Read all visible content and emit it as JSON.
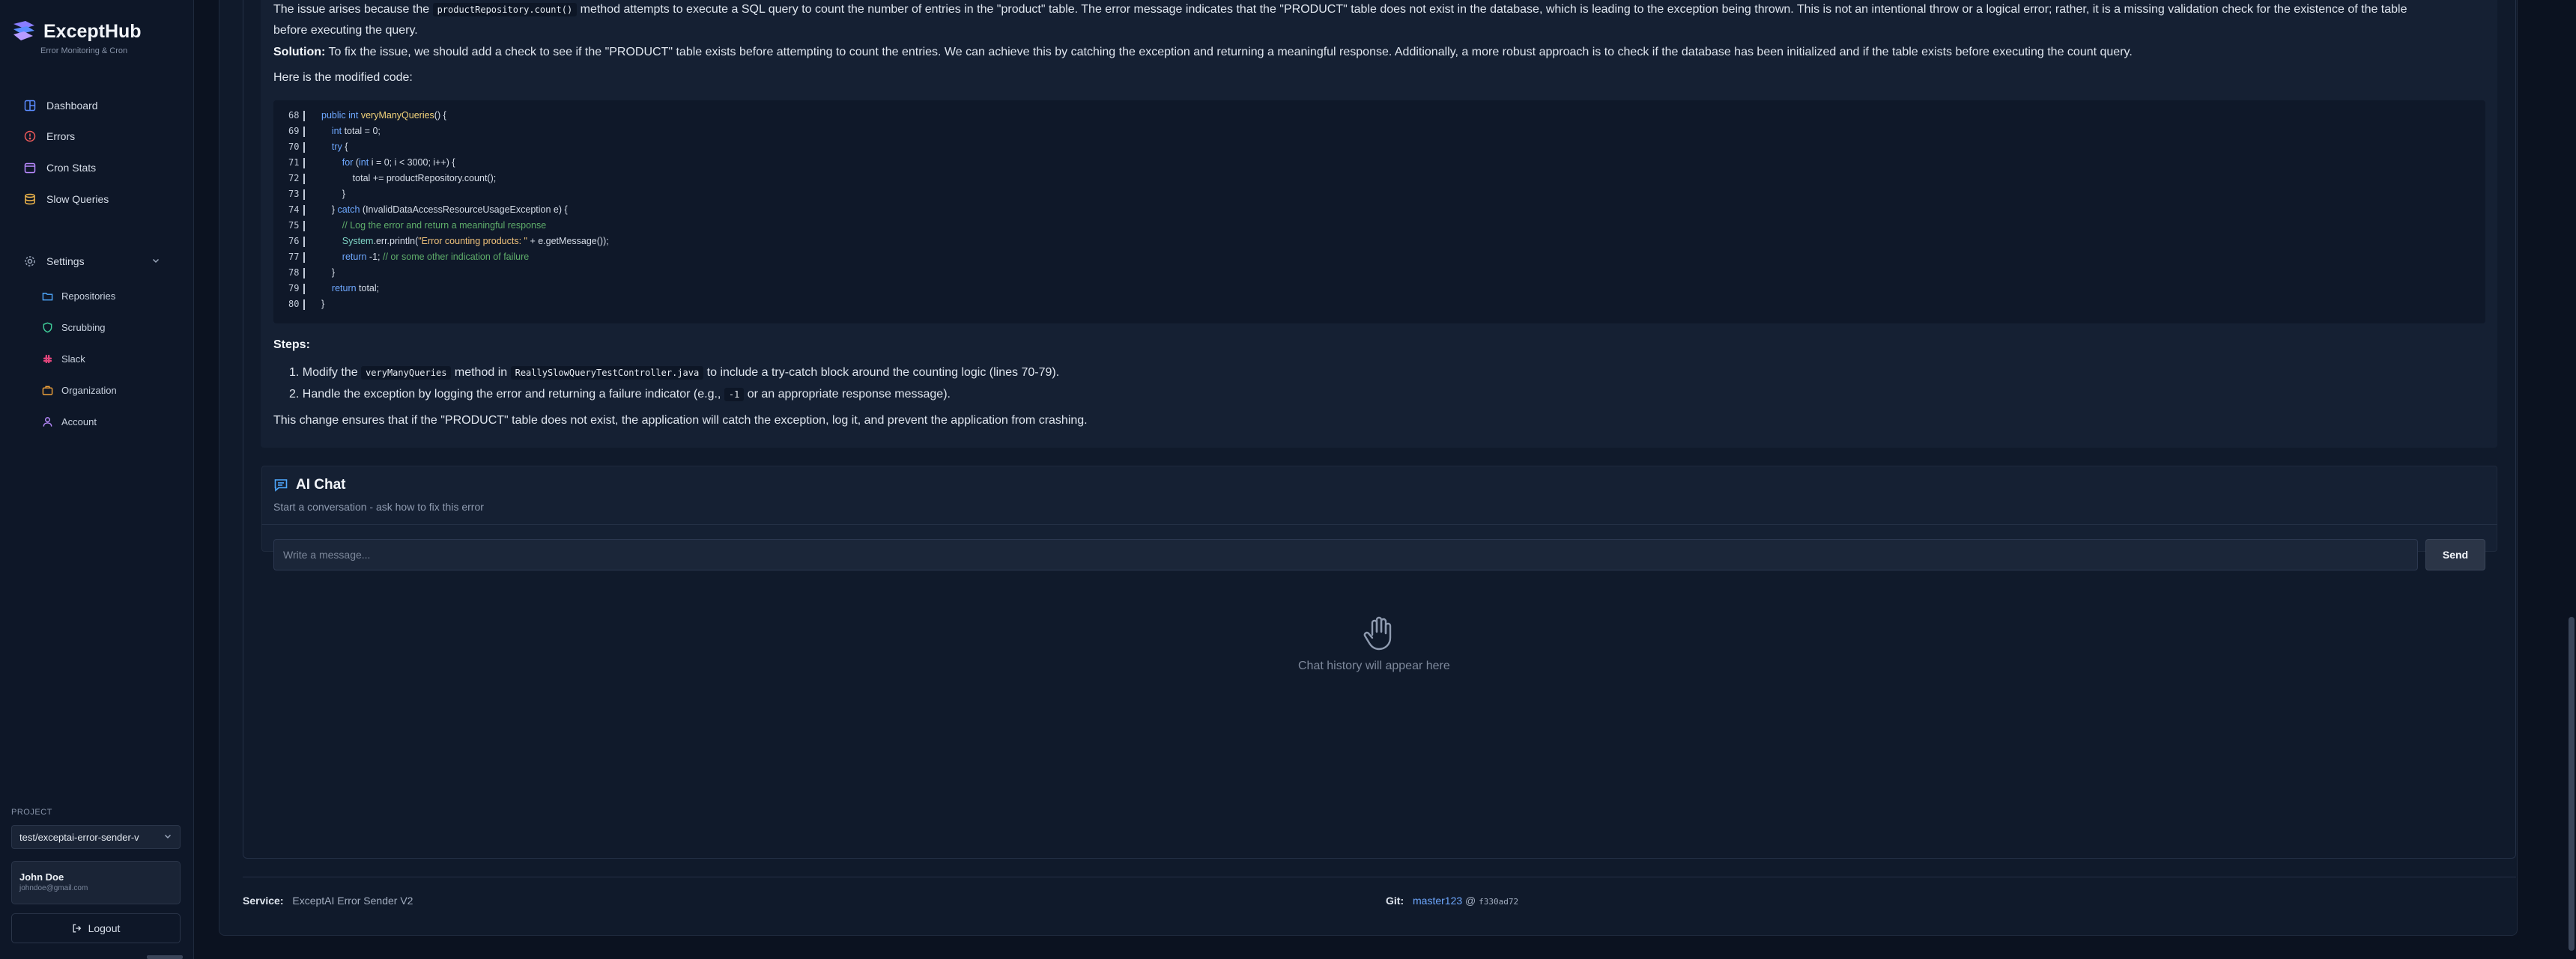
{
  "app": {
    "name": "ExceptHub",
    "subtitle": "Error Monitoring & Cron"
  },
  "sidebar": {
    "items": [
      {
        "label": "Dashboard",
        "icon": "dashboard-icon"
      },
      {
        "label": "Errors",
        "icon": "alert-circle-icon"
      },
      {
        "label": "Cron Stats",
        "icon": "calendar-icon"
      },
      {
        "label": "Slow Queries",
        "icon": "database-icon"
      }
    ],
    "settings": {
      "label": "Settings",
      "icon": "gear-icon",
      "expanded": true,
      "children": [
        {
          "label": "Repositories",
          "icon": "folder-icon"
        },
        {
          "label": "Scrubbing",
          "icon": "shield-icon"
        },
        {
          "label": "Slack",
          "icon": "slack-icon"
        },
        {
          "label": "Organization",
          "icon": "briefcase-icon"
        },
        {
          "label": "Account",
          "icon": "user-icon"
        }
      ]
    },
    "project_label": "PROJECT",
    "project_value": "test/exceptai-error-sender-v",
    "user": {
      "name": "John Doe",
      "email": "johndoe@gmail.com"
    },
    "logout_label": "Logout"
  },
  "analysis": {
    "para1_before": "The issue arises because the ",
    "para1_code": "productRepository.count()",
    "para1_after": " method attempts to execute a SQL query to count the number of entries in the \"product\" table. The error message indicates that the \"PRODUCT\" table does not exist in the database, which is leading to the exception being thrown. This is not an intentional throw or a logical error; rather, it is a missing validation check for the existence of the table before executing the query.",
    "solution_label": "Solution:",
    "solution_text": " To fix the issue, we should add a check to see if the \"PRODUCT\" table exists before attempting to count the entries. We can achieve this by catching the exception and returning a meaningful response. Additionally, a more robust approach is to check if the database has been initialized and if the table exists before executing the count query.",
    "modified_code_label": "Here is the modified code:",
    "code_lines": [
      {
        "n": "68",
        "text": "public int veryManyQueries() {"
      },
      {
        "n": "69",
        "text": "    int total = 0;"
      },
      {
        "n": "70",
        "text": "    try {"
      },
      {
        "n": "71",
        "text": "        for (int i = 0; i < 3000; i++) {"
      },
      {
        "n": "72",
        "text": "            total += productRepository.count();"
      },
      {
        "n": "73",
        "text": "        }"
      },
      {
        "n": "74",
        "text": "    } catch (InvalidDataAccessResourceUsageException e) {"
      },
      {
        "n": "75",
        "text": "        // Log the error and return a meaningful response"
      },
      {
        "n": "76",
        "text": "        System.err.println(\"Error counting products: \" + e.getMessage());"
      },
      {
        "n": "77",
        "text": "        return -1; // or some other indication of failure"
      },
      {
        "n": "78",
        "text": "    }"
      },
      {
        "n": "79",
        "text": "    return total;"
      },
      {
        "n": "80",
        "text": "}"
      }
    ],
    "steps_title": "Steps:",
    "step1_num": "1.",
    "step1_before": "Modify the ",
    "step1_code1": "veryManyQueries",
    "step1_mid": " method in ",
    "step1_code2": "ReallySlowQueryTestController.java",
    "step1_after": " to include a try-catch block around the counting logic (lines 70-79).",
    "step2_num": "2.",
    "step2_before": "Handle the exception by logging the error and returning a failure indicator (e.g., ",
    "step2_code": "-1",
    "step2_after": " or an appropriate response message).",
    "conclusion": "This change ensures that if the \"PRODUCT\" table does not exist, the application will catch the exception, log it, and prevent the application from crashing."
  },
  "chat": {
    "title": "AI Chat",
    "subtitle": "Start a conversation - ask how to fix this error",
    "input_placeholder": "Write a message...",
    "send_label": "Send",
    "empty_text": "Chat history will appear here"
  },
  "footer": {
    "service_label": "Service:",
    "service_value": "ExceptAI Error Sender V2",
    "git_label": "Git:",
    "git_branch": "master123",
    "git_at": "@",
    "git_hash": "f330ad72"
  },
  "colors": {
    "background": "#0b1220",
    "sidebar": "#0e1728",
    "card": "#152033",
    "accent": "#6ea8ff"
  }
}
